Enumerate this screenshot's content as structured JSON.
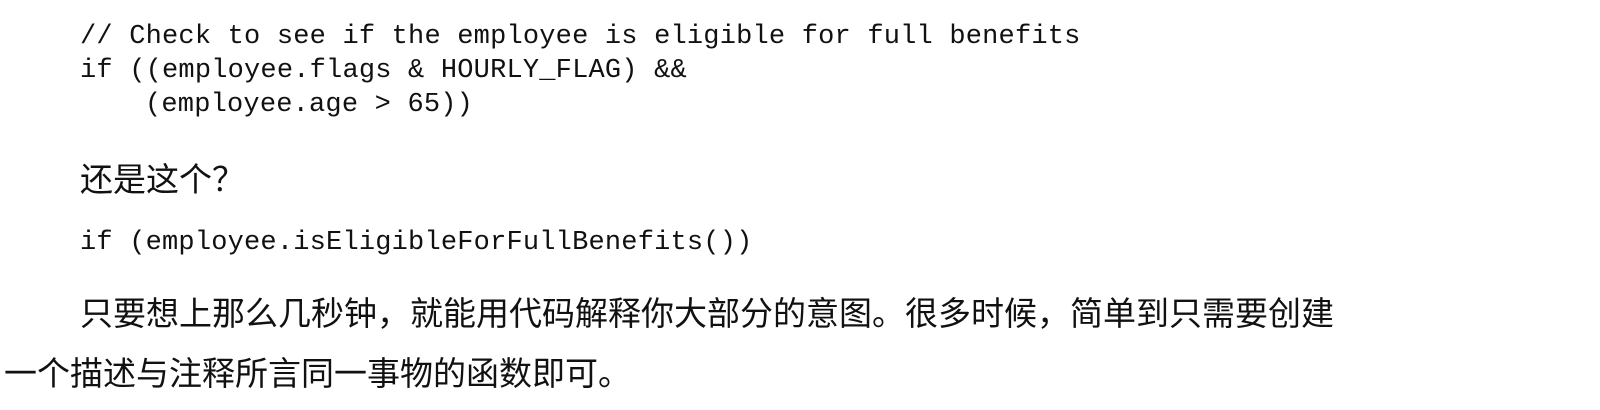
{
  "code_block_1": {
    "lines": [
      "// Check to see if the employee is eligible for full benefits",
      "if ((employee.flags & HOURLY_FLAG) &&",
      "(employee.age > 65))"
    ]
  },
  "question": "还是这个？",
  "code_block_2": {
    "lines": [
      "if (employee.isEligibleForFullBenefits())"
    ]
  },
  "paragraph": {
    "line1": "只要想上那么几秒钟，就能用代码解释你大部分的意图。很多时候，简单到只需要创建",
    "line2": "一个描述与注释所言同一事物的函数即可。"
  }
}
